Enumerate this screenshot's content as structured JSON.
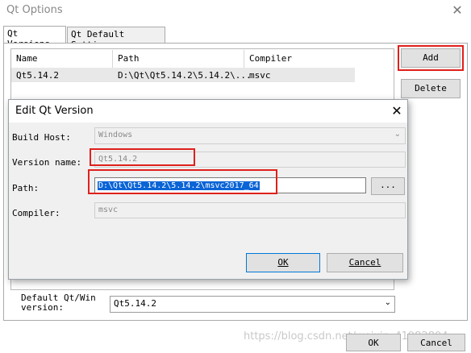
{
  "window": {
    "title": "Qt Options"
  },
  "tabs": [
    {
      "label": "Qt Versions"
    },
    {
      "label": "Qt Default Settings"
    }
  ],
  "table": {
    "headers": [
      "Name",
      "Path",
      "Compiler"
    ],
    "rows": [
      {
        "name": "Qt5.14.2",
        "path": "D:\\Qt\\Qt5.14.2\\5.14.2\\...",
        "compiler": "msvc"
      }
    ]
  },
  "buttons": {
    "add": "Add",
    "delete": "Delete",
    "ok": "OK",
    "cancel": "Cancel"
  },
  "dialog": {
    "title": "Edit Qt Version",
    "build_host_label": "Build Host:",
    "build_host_value": "Windows",
    "version_name_label": "Version name:",
    "version_name_value": "Qt5.14.2",
    "path_label": "Path:",
    "path_value": "D:\\Qt\\Qt5.14.2\\5.14.2\\msvc2017_64",
    "browse_label": "...",
    "compiler_label": "Compiler:",
    "compiler_value": "msvc",
    "ok_label": "OK",
    "cancel_label": "Cancel"
  },
  "default_version": {
    "label_line1": "Default Qt/Win",
    "label_line2": "version:",
    "value": "Qt5.14.2"
  },
  "watermark": "https://blog.csdn.net/weixin_41982804",
  "colors": {
    "highlight_box": "#e0201b",
    "selection": "#0a64d6"
  }
}
